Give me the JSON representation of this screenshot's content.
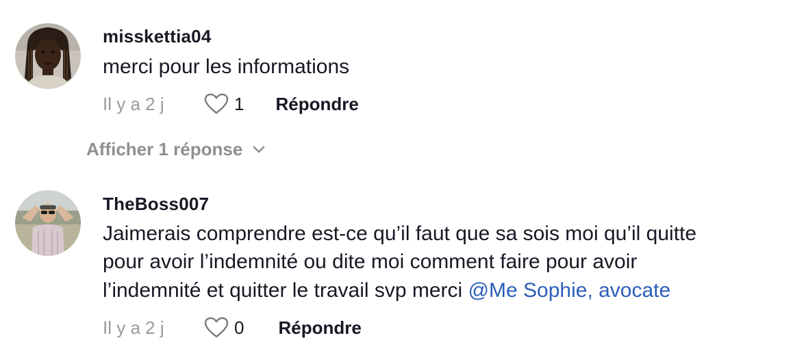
{
  "comments": [
    {
      "username": "misskettia04",
      "text_lines": [
        "merci pour les informations"
      ],
      "time": "Il y a 2 j",
      "likes": "1",
      "reply_label": "Répondre",
      "avatar": "avatar-woman-braids"
    },
    {
      "username": "TheBoss007",
      "text_lines": [
        "Jaimerais comprendre est-ce qu’il faut que sa sois moi qu’il quitte",
        "pour avoir l’indemnité ou dite moi comment faire pour avoir",
        "l’indemnité et quitter le travail svp merci"
      ],
      "mention": "@Me Sophie, avocate",
      "time": "Il y a 2 j",
      "likes": "0",
      "reply_label": "Répondre",
      "avatar": "avatar-man-sunglasses"
    }
  ],
  "show_replies_label": "Afficher 1 réponse",
  "icons": {
    "like": "heart-outline-icon",
    "expand": "chevron-down-icon"
  },
  "colors": {
    "text": "#161823",
    "muted": "#9a9a9a",
    "mention": "#2b5db9"
  }
}
